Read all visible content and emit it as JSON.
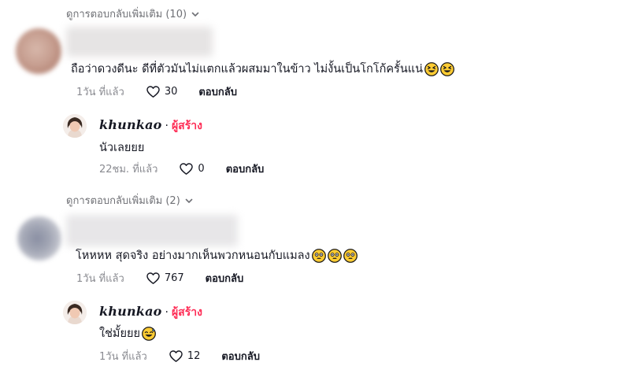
{
  "view_more_1": {
    "label": "ดูการตอบกลับเพิ่มเติม (10)",
    "icon": "chevron-down-icon"
  },
  "comment_1": {
    "text": "ถือว่าดวงดีนะ ดีที่ตัวมันไม่แตกแล้วผสมมาในข้าว ไม่งั้นเป็นโกโก้ครั้นแน่",
    "time": "1วัน ที่แล้ว",
    "likes": "30",
    "reply_label": "ตอบกลับ"
  },
  "reply_1": {
    "author": "khunkao",
    "separator": "·",
    "tag": "ผู้สร้าง",
    "text": "นัวเลยยย",
    "time": "22ชม. ที่แล้ว",
    "likes": "0",
    "reply_label": "ตอบกลับ"
  },
  "view_more_2": {
    "label": "ดูการตอบกลับเพิ่มเติม (2)",
    "icon": "chevron-down-icon"
  },
  "comment_2": {
    "text": "โหหหห สุดจริง อย่างมากเห็นพวกหนอนกับแมลง",
    "time": "1วัน ที่แล้ว",
    "likes": "767",
    "reply_label": "ตอบกลับ"
  },
  "reply_2": {
    "author": "khunkao",
    "separator": "·",
    "tag": "ผู้สร้าง",
    "text": "ใช่มั้ยยย",
    "time": "1วัน ที่แล้ว",
    "likes": "12",
    "reply_label": "ตอบกลับ"
  },
  "colors": {
    "creator_tag": "#fe2c55",
    "text": "#161823",
    "muted": "#8a8b91"
  }
}
